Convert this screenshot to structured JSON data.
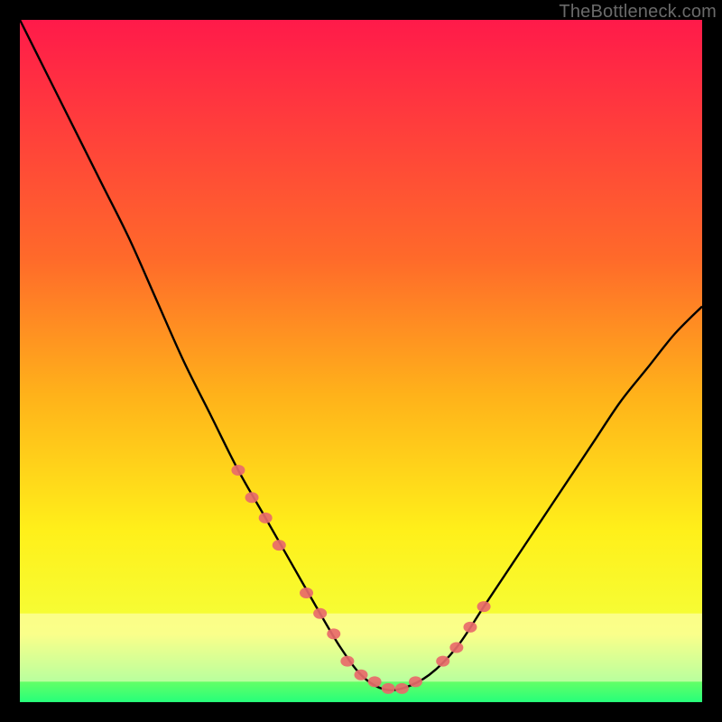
{
  "watermark": "TheBottleneck.com",
  "chart_data": {
    "type": "line",
    "title": "",
    "xlabel": "",
    "ylabel": "",
    "xlim": [
      0,
      100
    ],
    "ylim": [
      0,
      100
    ],
    "gradient_stops": [
      {
        "offset": 0,
        "color": "#ff1a4a"
      },
      {
        "offset": 35,
        "color": "#ff6a2a"
      },
      {
        "offset": 55,
        "color": "#ffb21a"
      },
      {
        "offset": 75,
        "color": "#fff01a"
      },
      {
        "offset": 90,
        "color": "#f4ff3a"
      },
      {
        "offset": 100,
        "color": "#26ff7a"
      }
    ],
    "series": [
      {
        "name": "bottleneck-curve",
        "color": "#000000",
        "x": [
          0,
          4,
          8,
          12,
          16,
          20,
          24,
          28,
          32,
          36,
          40,
          44,
          47,
          50,
          53,
          56,
          60,
          64,
          68,
          72,
          76,
          80,
          84,
          88,
          92,
          96,
          100
        ],
        "y": [
          100,
          92,
          84,
          76,
          68,
          59,
          50,
          42,
          34,
          27,
          20,
          13,
          8,
          4,
          2,
          2,
          4,
          8,
          14,
          20,
          26,
          32,
          38,
          44,
          49,
          54,
          58
        ]
      },
      {
        "name": "highlight-markers",
        "color": "#e86a6a",
        "type": "scatter",
        "x": [
          32,
          34,
          36,
          38,
          42,
          44,
          46,
          48,
          50,
          52,
          54,
          56,
          58,
          62,
          64,
          66,
          68
        ],
        "y": [
          34,
          30,
          27,
          23,
          16,
          13,
          10,
          6,
          4,
          3,
          2,
          2,
          3,
          6,
          8,
          11,
          14
        ]
      }
    ]
  }
}
